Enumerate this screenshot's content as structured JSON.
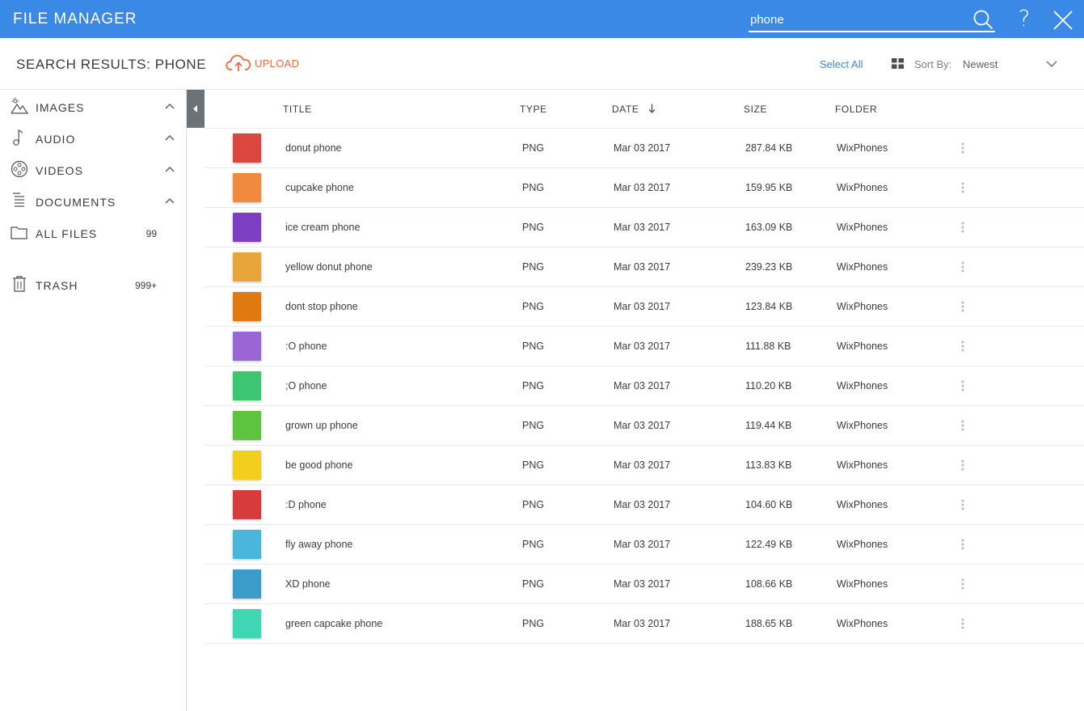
{
  "app": {
    "title": "FILE MANAGER"
  },
  "search": {
    "value": "phone"
  },
  "header": {
    "title": "SEARCH RESULTS: PHONE",
    "upload_label": "UPLOAD",
    "select_all_label": "Select All",
    "sort_label": "Sort By:",
    "sort_value": "Newest"
  },
  "sidebar": {
    "items": [
      {
        "label": "IMAGES",
        "icon": "images-icon"
      },
      {
        "label": "AUDIO",
        "icon": "audio-icon"
      },
      {
        "label": "VIDEOS",
        "icon": "videos-icon"
      },
      {
        "label": "DOCUMENTS",
        "icon": "documents-icon"
      },
      {
        "label": "ALL FILES",
        "icon": "folder-icon",
        "count": "99"
      },
      {
        "label": "TRASH",
        "icon": "trash-icon",
        "count": "999+"
      }
    ]
  },
  "table": {
    "columns": {
      "title": "TITLE",
      "type": "TYPE",
      "date": "DATE",
      "size": "SIZE",
      "folder": "FOLDER"
    },
    "rows": [
      {
        "title": "donut phone",
        "type": "PNG",
        "date": "Mar 03 2017",
        "size": "287.84 KB",
        "folder": "WixPhones",
        "color": "#d9473f"
      },
      {
        "title": "cupcake phone",
        "type": "PNG",
        "date": "Mar 03 2017",
        "size": "159.95 KB",
        "folder": "WixPhones",
        "color": "#f08a3c"
      },
      {
        "title": "ice cream phone",
        "type": "PNG",
        "date": "Mar 03 2017",
        "size": "163.09 KB",
        "folder": "WixPhones",
        "color": "#7d3fc2"
      },
      {
        "title": "yellow donut phone",
        "type": "PNG",
        "date": "Mar 03 2017",
        "size": "239.23 KB",
        "folder": "WixPhones",
        "color": "#e8a53a"
      },
      {
        "title": "dont stop phone",
        "type": "PNG",
        "date": "Mar 03 2017",
        "size": "123.84 KB",
        "folder": "WixPhones",
        "color": "#e07a10"
      },
      {
        "title": ":O phone",
        "type": "PNG",
        "date": "Mar 03 2017",
        "size": "111.88 KB",
        "folder": "WixPhones",
        "color": "#9a66d6"
      },
      {
        "title": ";O phone",
        "type": "PNG",
        "date": "Mar 03 2017",
        "size": "110.20 KB",
        "folder": "WixPhones",
        "color": "#3dc672"
      },
      {
        "title": "grown up phone",
        "type": "PNG",
        "date": "Mar 03 2017",
        "size": "119.44 KB",
        "folder": "WixPhones",
        "color": "#5cc43f"
      },
      {
        "title": "be good phone",
        "type": "PNG",
        "date": "Mar 03 2017",
        "size": "113.83 KB",
        "folder": "WixPhones",
        "color": "#f2cf1c"
      },
      {
        "title": ":D phone",
        "type": "PNG",
        "date": "Mar 03 2017",
        "size": "104.60 KB",
        "folder": "WixPhones",
        "color": "#d83b3b"
      },
      {
        "title": "fly away phone",
        "type": "PNG",
        "date": "Mar 03 2017",
        "size": "122.49 KB",
        "folder": "WixPhones",
        "color": "#4bb6dc"
      },
      {
        "title": "XD phone",
        "type": "PNG",
        "date": "Mar 03 2017",
        "size": "108.66 KB",
        "folder": "WixPhones",
        "color": "#3b9bc9"
      },
      {
        "title": "green capcake phone",
        "type": "PNG",
        "date": "Mar 03 2017",
        "size": "188.65 KB",
        "folder": "WixPhones",
        "color": "#3fd6b4"
      }
    ]
  },
  "colors": {
    "topbar": "#3b89e6",
    "accent": "#3b89e6",
    "upload": "#f06a3c"
  }
}
